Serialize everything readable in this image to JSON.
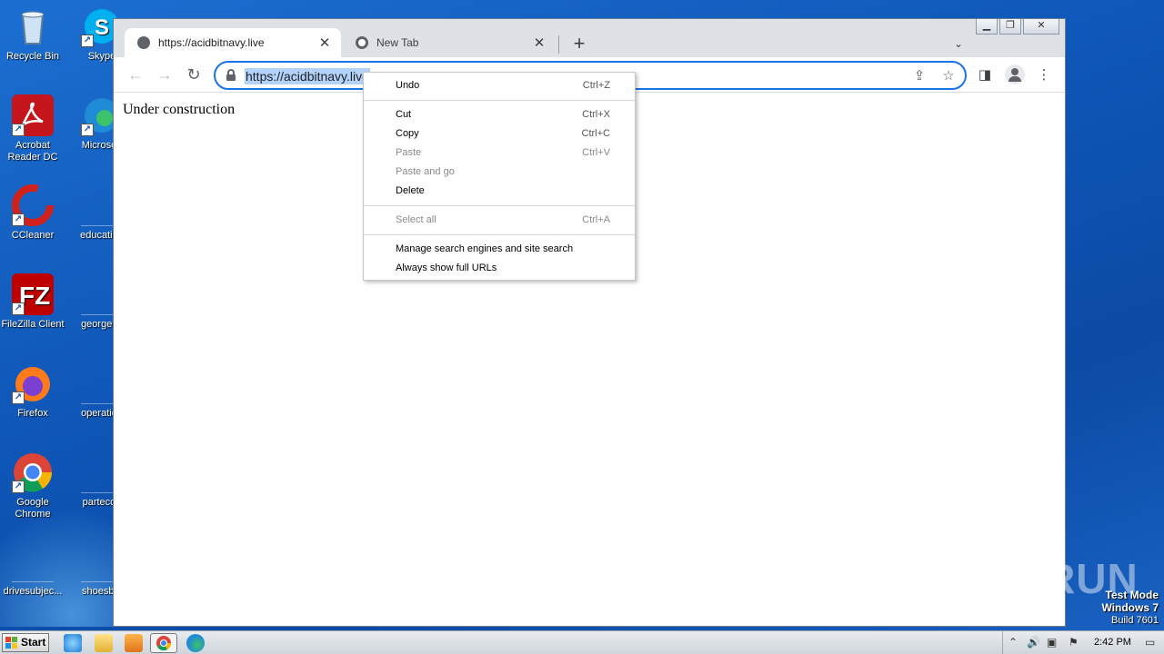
{
  "desktop": {
    "icons_left": [
      {
        "label": "Recycle Bin",
        "name": "recycle-bin"
      },
      {
        "label": "Acrobat Reader DC",
        "name": "acrobat-reader"
      },
      {
        "label": "CCleaner",
        "name": "ccleaner"
      },
      {
        "label": "FileZilla Client",
        "name": "filezilla"
      },
      {
        "label": "Firefox",
        "name": "firefox"
      },
      {
        "label": "Google Chrome",
        "name": "google-chrome"
      },
      {
        "label": "drivesubjec...",
        "name": "drivesubject-file"
      }
    ],
    "icons_right": [
      {
        "label": "Skype",
        "name": "skype"
      },
      {
        "label": "Microsoft",
        "name": "microsoft-edge"
      },
      {
        "label": "education",
        "name": "education-file"
      },
      {
        "label": "georgemi",
        "name": "georgemi-file"
      },
      {
        "label": "operation",
        "name": "operation-file"
      },
      {
        "label": "partecon",
        "name": "partecon-file"
      },
      {
        "label": "shoesbel",
        "name": "shoesbel-file"
      }
    ]
  },
  "browser": {
    "tabs": [
      {
        "title": "https://acidbitnavy.live",
        "active": true
      },
      {
        "title": "New Tab",
        "active": false
      }
    ],
    "new_tab_symbol": "+",
    "url": "https://acidbitnavy.live",
    "page_text": "Under construction"
  },
  "context_menu": {
    "items": [
      {
        "label": "Undo",
        "shortcut": "Ctrl+Z",
        "enabled": true
      },
      {
        "label": "Cut",
        "shortcut": "Ctrl+X",
        "enabled": true
      },
      {
        "label": "Copy",
        "shortcut": "Ctrl+C",
        "enabled": true
      },
      {
        "label": "Paste",
        "shortcut": "Ctrl+V",
        "enabled": false
      },
      {
        "label": "Paste and go",
        "shortcut": "",
        "enabled": false
      },
      {
        "label": "Delete",
        "shortcut": "",
        "enabled": true
      },
      {
        "label": "Select all",
        "shortcut": "Ctrl+A",
        "enabled": false
      },
      {
        "label": "Manage search engines and site search",
        "shortcut": "",
        "enabled": true
      },
      {
        "label": "Always show full URLs",
        "shortcut": "",
        "enabled": true
      }
    ]
  },
  "watermark": {
    "text": "ANY RUN",
    "test_mode": "Test Mode",
    "os": "Windows 7",
    "build": "Build 7601"
  },
  "taskbar": {
    "start_label": "Start",
    "clock": "2:42 PM"
  },
  "colors": {
    "accent": "#1a73e8",
    "selection": "#b3d3fc",
    "desktop": "#0f57b8"
  }
}
